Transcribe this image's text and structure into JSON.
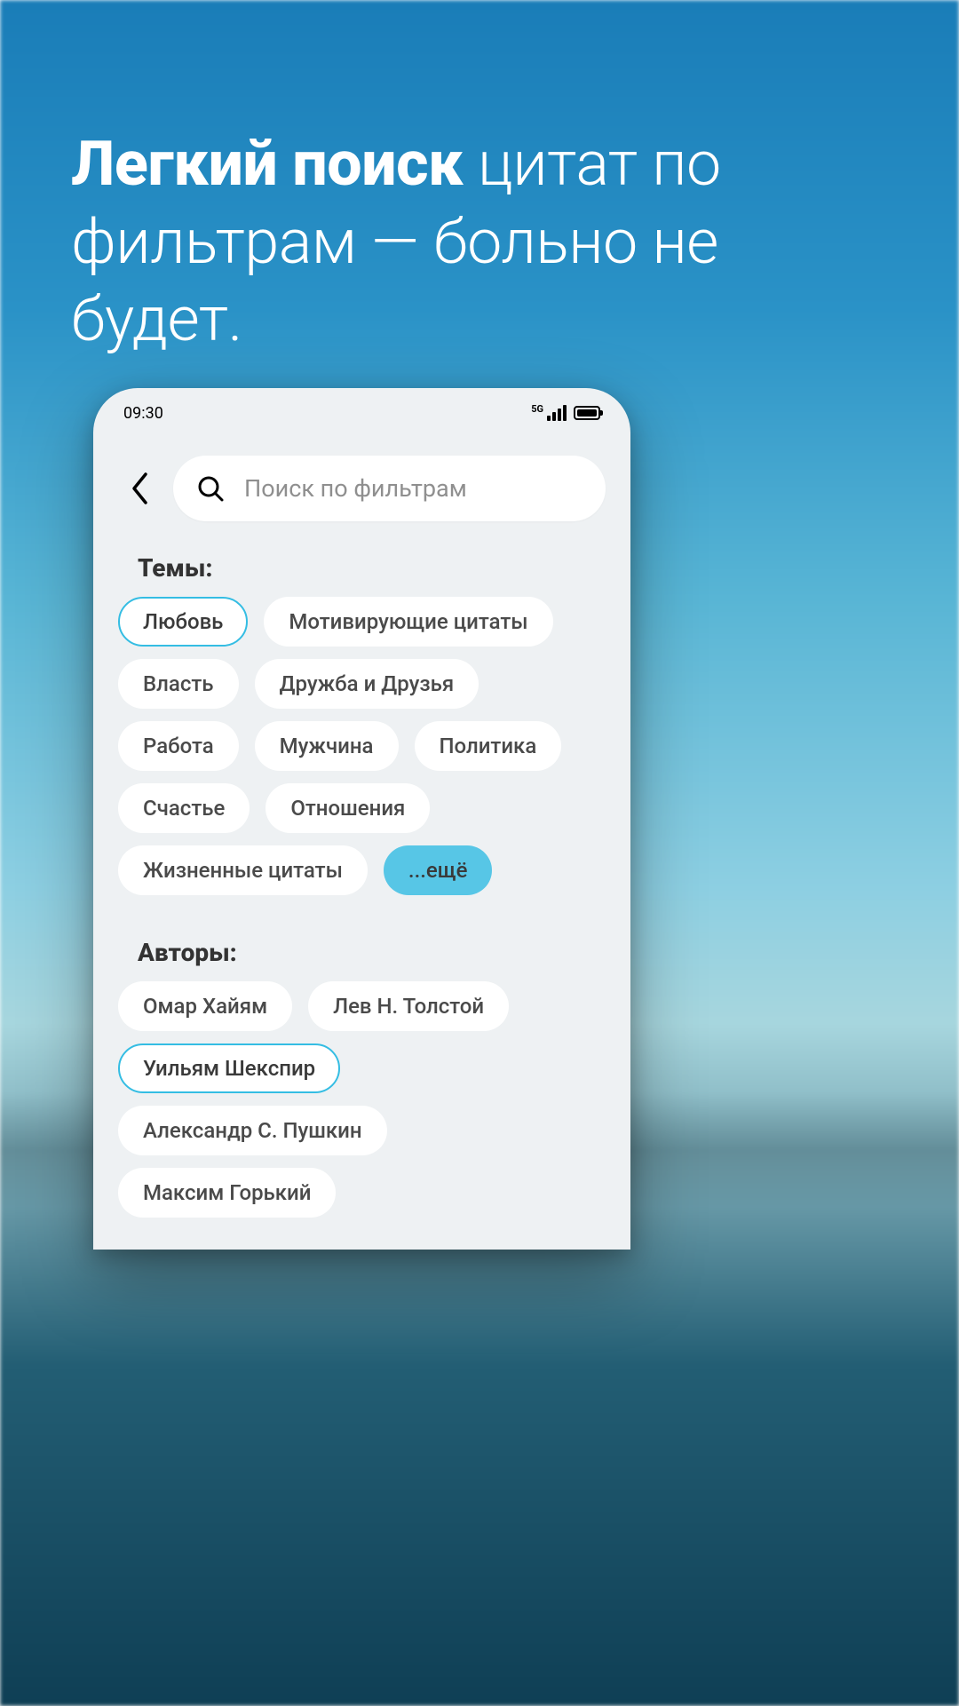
{
  "colors": {
    "accent": "#34bde3",
    "accent_fill": "#57c6e6"
  },
  "hero": {
    "bold": "Легкий поиск",
    "rest": " цитат по фильтрам  — больно не будет."
  },
  "status": {
    "time": "09:30",
    "network": "5G"
  },
  "search": {
    "placeholder": "Поиск по фильтрам"
  },
  "sections": {
    "themes": {
      "title": "Темы:",
      "chips": [
        {
          "label": "Любовь",
          "selected": true
        },
        {
          "label": "Мотивирующие цитаты"
        },
        {
          "label": "Власть"
        },
        {
          "label": "Дружба и Друзья"
        },
        {
          "label": "Работа"
        },
        {
          "label": "Мужчина"
        },
        {
          "label": "Политика"
        },
        {
          "label": "Счастье"
        },
        {
          "label": "Отношения"
        },
        {
          "label": "Жизненные цитаты"
        }
      ],
      "more_label": "...ещё"
    },
    "authors": {
      "title": "Авторы:",
      "chips": [
        {
          "label": "Омар Хайям"
        },
        {
          "label": "Лев Н. Толстой"
        },
        {
          "label": "Уильям Шекспир",
          "selected": true
        },
        {
          "label": "Александр С. Пушкин"
        },
        {
          "label": "Максим Горький"
        }
      ]
    }
  }
}
